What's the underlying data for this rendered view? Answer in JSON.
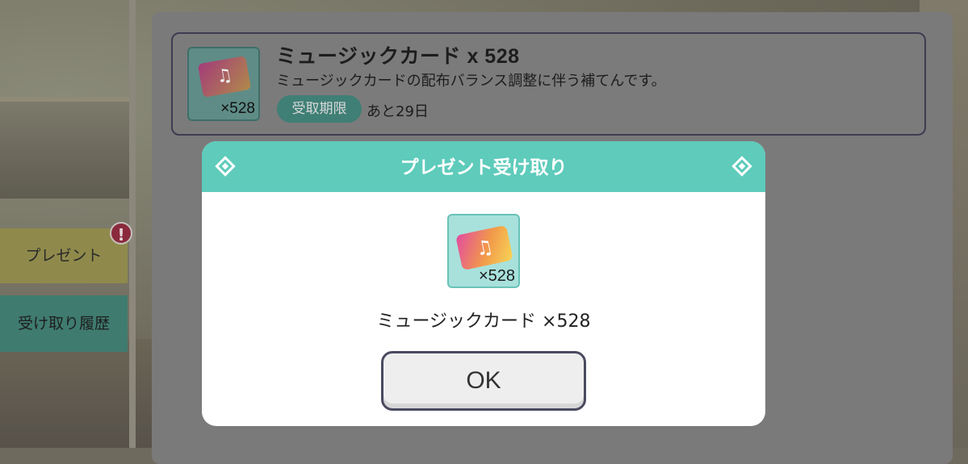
{
  "gift": {
    "title": "ミュージックカード x 528",
    "description": "ミュージックカードの配布バランス調整に伴う補てんです。",
    "badge": "受取期限",
    "remaining": "あと29日",
    "thumb_qty": "×528",
    "thumb_symbol": "♫"
  },
  "tabs": {
    "present": "プレゼント",
    "history": "受け取り履歴",
    "alert": "!"
  },
  "dialog": {
    "title": "プレゼント受け取り",
    "icon_qty": "×528",
    "icon_symbol": "♫",
    "item_label": "ミュージックカード ×528",
    "ok": "OK"
  },
  "colors": {
    "header": "#5ecbbb",
    "accent": "#3f7f75"
  }
}
